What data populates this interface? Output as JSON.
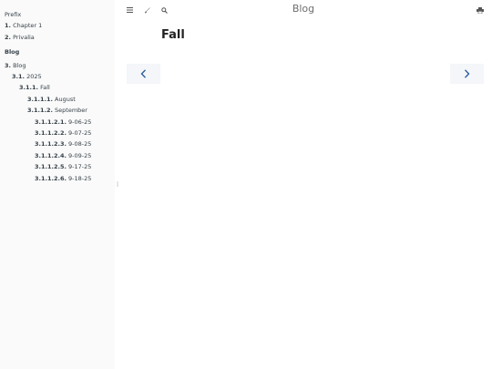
{
  "toolbar": {
    "title": "Blog",
    "icons": [
      "menu-icon",
      "brush-icon",
      "search-icon",
      "print-icon"
    ]
  },
  "sidebar": {
    "prefix": "Prefix",
    "chapter1": {
      "num": "1.",
      "label": "Chapter 1"
    },
    "privalia": {
      "num": "2.",
      "label": "Privalia"
    },
    "part_title": "Blog",
    "blog": {
      "num": "3.",
      "label": "Blog"
    },
    "year": {
      "num": "3.1.",
      "label": "2025"
    },
    "fall": {
      "num": "3.1.1.",
      "label": "Fall"
    },
    "august": {
      "num": "3.1.1.1.",
      "label": "August"
    },
    "september": {
      "num": "3.1.1.2.",
      "label": "September"
    },
    "posts": [
      {
        "num": "3.1.1.2.1.",
        "label": "9-06-25"
      },
      {
        "num": "3.1.1.2.2.",
        "label": "9-07-25"
      },
      {
        "num": "3.1.1.2.3.",
        "label": "9-08-25"
      },
      {
        "num": "3.1.1.2.4.",
        "label": "9-09-25"
      },
      {
        "num": "3.1.1.2.5.",
        "label": "9-17-25"
      },
      {
        "num": "3.1.1.2.6.",
        "label": "9-18-25"
      }
    ]
  },
  "main": {
    "heading": "Fall"
  },
  "colors": {
    "sidebar_bg": "#fafafa",
    "nav_button_bg": "#f4f6f9",
    "arrow": "#2b5b9e"
  }
}
